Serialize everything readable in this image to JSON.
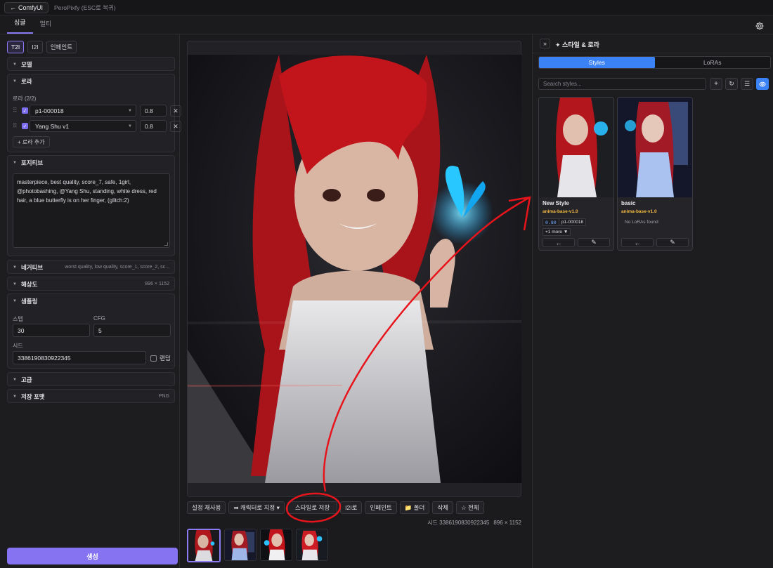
{
  "topbar": {
    "back_label": "ComfyUI",
    "app_subtitle": "PeroPixfy (ESC로 복귀)"
  },
  "tabs": [
    {
      "label": "싱글",
      "active": true
    },
    {
      "label": "멀티",
      "active": false
    }
  ],
  "left": {
    "modes": [
      {
        "label": "T2I",
        "active": true
      },
      {
        "label": "I2I",
        "active": false
      },
      {
        "label": "인페인트",
        "active": false
      }
    ],
    "model_section": {
      "title": "모델"
    },
    "lora_section": {
      "title": "로라",
      "count_label": "로라 (2/2)",
      "rows": [
        {
          "name": "p1-000018",
          "weight": "0.8"
        },
        {
          "name": "Yang Shu v1",
          "weight": "0.8"
        }
      ],
      "add_label": "+ 로라 추가"
    },
    "positive_section": {
      "title": "포지티브",
      "text": "masterpiece, best quality, score_7, safe, 1girl, @photobashing, @Yang Shu, standing, white dress, red hair, a blue butterfly is on her finger, (glitch:2)"
    },
    "negative_section": {
      "title": "네거티브",
      "summary": "worst quality, low quality, score_1, score_2, sc..."
    },
    "resolution_section": {
      "title": "해상도",
      "summary": "896 × 1152"
    },
    "sampling_section": {
      "title": "샘플링",
      "steps_label": "스텝",
      "steps_value": "30",
      "cfg_label": "CFG",
      "cfg_value": "5",
      "seed_label": "시드",
      "seed_value": "3386190830922345",
      "random_label": "랜덤"
    },
    "advanced_section": {
      "title": "고급"
    },
    "save_format_section": {
      "title": "저장 포맷",
      "summary": "PNG"
    },
    "generate_label": "생성"
  },
  "center": {
    "actions": [
      {
        "label": "설정 재사용"
      },
      {
        "label": "➡ 캐릭터로 지정 ▾"
      },
      {
        "label": "스타일로 저장"
      },
      {
        "label": "I2I로"
      },
      {
        "label": "인페인트"
      },
      {
        "label": "📁 폴더"
      },
      {
        "label": "삭제"
      },
      {
        "label": "☆ 전체"
      }
    ],
    "seed_info": "시드 3386190830922345",
    "size_info": "896 × 1152"
  },
  "right": {
    "title": "✦ 스타일 & 로라",
    "tabs": [
      {
        "label": "Styles",
        "active": true
      },
      {
        "label": "LoRAs",
        "active": false
      }
    ],
    "search_placeholder": "Search styles...",
    "cards": [
      {
        "name": "New Style",
        "model": "anima-base-v1.0",
        "lora_weight": "0.80",
        "lora_name": "p1-000018",
        "more_label": "+1 more ▼"
      },
      {
        "name": "basic",
        "model": "anima-base-v1.0",
        "empty_label": "No LoRAs found"
      }
    ]
  },
  "colors": {
    "accent": "#8b7cf6",
    "blue": "#3b82f6",
    "model_tag": "#f5b841",
    "annotation": "#e8141c"
  }
}
